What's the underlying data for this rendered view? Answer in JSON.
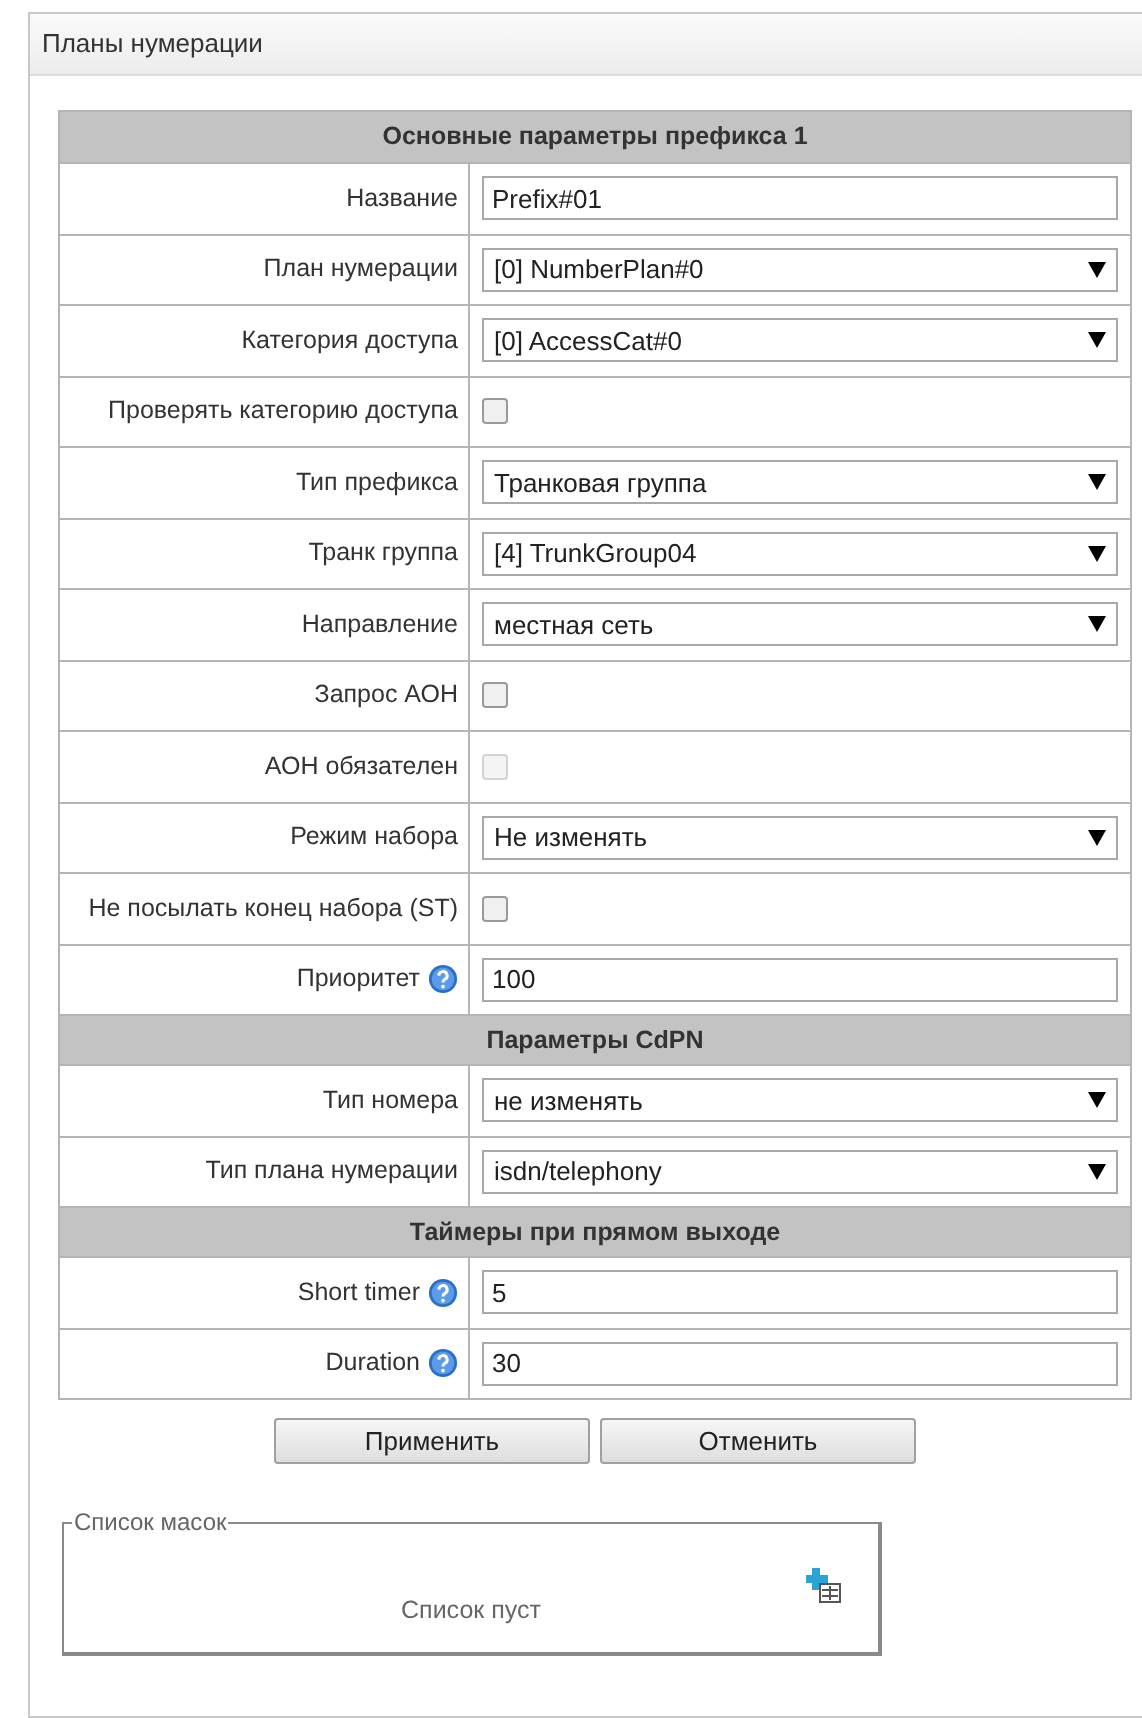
{
  "panel": {
    "title": "Планы нумерации"
  },
  "sections": [
    {
      "title": "Основные параметры префикса 1",
      "rows": [
        {
          "kind": "text",
          "label": "Название",
          "value": "Prefix#01",
          "help": false
        },
        {
          "kind": "select",
          "label": "План нумерации",
          "value": "[0] NumberPlan#0"
        },
        {
          "kind": "select",
          "label": "Категория доступа",
          "value": "[0] AccessCat#0"
        },
        {
          "kind": "checkbox",
          "label": "Проверять категорию доступа",
          "checked": false,
          "disabled": false
        },
        {
          "kind": "select",
          "label": "Тип префикса",
          "value": "Транковая группа"
        },
        {
          "kind": "select",
          "label": "Транк группа",
          "value": "[4] TrunkGroup04"
        },
        {
          "kind": "select",
          "label": "Направление",
          "value": "местная сеть"
        },
        {
          "kind": "checkbox",
          "label": "Запрос АОН",
          "checked": false,
          "disabled": false
        },
        {
          "kind": "checkbox",
          "label": "АОН обязателен",
          "checked": false,
          "disabled": true
        },
        {
          "kind": "select",
          "label": "Режим набора",
          "value": "Не изменять"
        },
        {
          "kind": "checkbox",
          "label": "Не посылать конец набора (ST)",
          "checked": false,
          "disabled": false
        },
        {
          "kind": "text",
          "label": "Приоритет",
          "value": "100",
          "help": true
        }
      ]
    },
    {
      "title": "Параметры CdPN",
      "rows": [
        {
          "kind": "select",
          "label": "Тип номера",
          "value": "не изменять"
        },
        {
          "kind": "select",
          "label": "Тип плана нумерации",
          "value": "isdn/telephony"
        }
      ]
    },
    {
      "title": "Таймеры при прямом выходе",
      "rows": [
        {
          "kind": "text",
          "label": "Short timer",
          "value": "5",
          "help": true
        },
        {
          "kind": "text",
          "label": "Duration",
          "value": "30",
          "help": true
        }
      ]
    }
  ],
  "buttons": [
    "Применить",
    "Отменить"
  ],
  "mask_list": {
    "legend": "Список масок",
    "empty_text": "Список пуст"
  }
}
